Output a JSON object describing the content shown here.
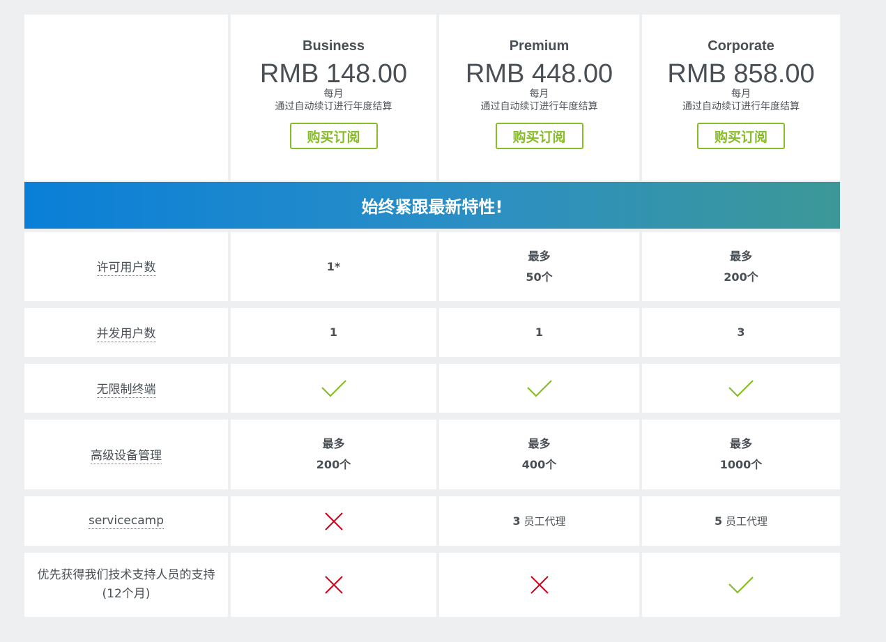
{
  "plans": [
    {
      "name": "Business",
      "price": "RMB 148.00",
      "period": "每月",
      "billing": "通过自动续订进行年度结算",
      "buy_label": "购买订阅"
    },
    {
      "name": "Premium",
      "price": "RMB 448.00",
      "period": "每月",
      "billing": "通过自动续订进行年度结算",
      "buy_label": "购买订阅"
    },
    {
      "name": "Corporate",
      "price": "RMB 858.00",
      "period": "每月",
      "billing": "通过自动续订进行年度结算",
      "buy_label": "购买订阅"
    }
  ],
  "banner": {
    "text": "始终紧跟最新特性!"
  },
  "features": [
    {
      "label": "许可用户数",
      "values": [
        {
          "line1": "1*"
        },
        {
          "line1": "最多",
          "line2": "50个"
        },
        {
          "line1": "最多",
          "line2": "200个"
        }
      ]
    },
    {
      "label": "并发用户数",
      "values": [
        {
          "line1": "1"
        },
        {
          "line1": "1"
        },
        {
          "line1": "3"
        }
      ]
    },
    {
      "label": "无限制终端",
      "values": [
        {
          "icon": "check-icon"
        },
        {
          "icon": "check-icon"
        },
        {
          "icon": "check-icon"
        }
      ]
    },
    {
      "label": "高级设备管理",
      "values": [
        {
          "line1": "最多",
          "line2": "200个"
        },
        {
          "line1": "最多",
          "line2": "400个"
        },
        {
          "line1": "最多",
          "line2": "1000个"
        }
      ]
    },
    {
      "label": "servicecamp",
      "values": [
        {
          "icon": "cross-icon"
        },
        {
          "num": "3",
          "text": " 员工代理"
        },
        {
          "num": "5",
          "text": " 员工代理"
        }
      ]
    },
    {
      "label_line1": "优先获得我们技术支持人员的支持",
      "label_line2": "(12个月)",
      "values": [
        {
          "icon": "cross-icon"
        },
        {
          "icon": "cross-icon"
        },
        {
          "icon": "check-icon"
        }
      ]
    }
  ],
  "colors": {
    "accent_green": "#86bc25",
    "cross_red": "#d0021b",
    "banner_start": "#0a7fd8",
    "banner_end": "#3c9897"
  }
}
